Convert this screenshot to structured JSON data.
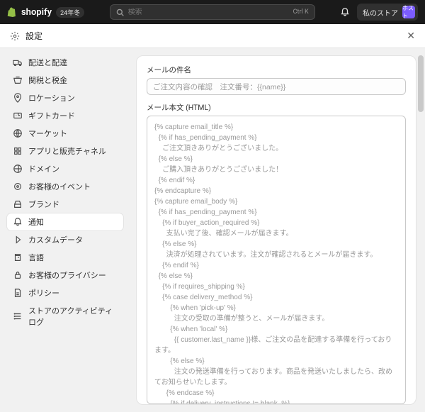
{
  "topbar": {
    "brand": "shopify",
    "season_badge": "24年冬",
    "search_placeholder": "検索",
    "search_shortcut": "Ctrl K",
    "store_label": "私のストア",
    "avatar_text": "ホスト"
  },
  "settings": {
    "title": "設定"
  },
  "sidebar": {
    "items": [
      {
        "label": "配送と配達"
      },
      {
        "label": "関税と税金"
      },
      {
        "label": "ロケーション"
      },
      {
        "label": "ギフトカード"
      },
      {
        "label": "マーケット"
      },
      {
        "label": "アプリと販売チャネル"
      },
      {
        "label": "ドメイン"
      },
      {
        "label": "お客様のイベント"
      },
      {
        "label": "ブランド"
      },
      {
        "label": "通知",
        "active": true
      },
      {
        "label": "カスタムデータ"
      },
      {
        "label": "言語"
      },
      {
        "label": "お客様のプライバシー"
      },
      {
        "label": "ポリシー"
      },
      {
        "label": "ストアのアクティビティログ"
      }
    ]
  },
  "main": {
    "subject_label": "メールの件名",
    "subject_value": "ご注文内容の確認　注文番号：{{name}}",
    "body_label": "メール本文 (HTML)",
    "body_code": "{% capture email_title %}\n  {% if has_pending_payment %}\n    ご注文頂きありがとうございました。\n  {% else %}\n    ご購入頂きありがとうございました！\n  {% endif %}\n{% endcapture %}\n{% capture email_body %}\n  {% if has_pending_payment %}\n    {% if buyer_action_required %}\n      支払い完了後、確認メールが届きます。\n    {% else %}\n      決済が処理されています。注文が確認されるとメールが届きます。\n    {% endif %}\n  {% else %}\n    {% if requires_shipping %}\n    {% case delivery_method %}\n        {% when 'pick-up' %}\n          注文の受取の準備が整うと、メールが届きます。\n        {% when 'local' %}\n          {{ customer.last_name }}様、ご注文の品を配達する準備を行っております。\n        {% else %}\n          注文の発送準備を行っております。商品を発送いたしましたら、改めてお知らせいたします。\n      {% endcase %}\n        {% if delivery_instructions != blank  %}\n          <p><b>配達情報:</b> {{ delivery_instructions }}</p>\n        {% endif %}\n       {% if consolidated_estimated_delivery_time %}\n        {% if has_multiple_delivery_methods %}\n          <h3 class=\"estimated_delivery__title\">配達予定</h3>\n          <p>{{ consolidated_estimated_delivery_time }}</p>\n        {% else %}\n          <p>\n            配達予定 <b>{{ consolidated_estimated_delivery_time }}</b>\n          </p>\n        {% endif %}"
  }
}
